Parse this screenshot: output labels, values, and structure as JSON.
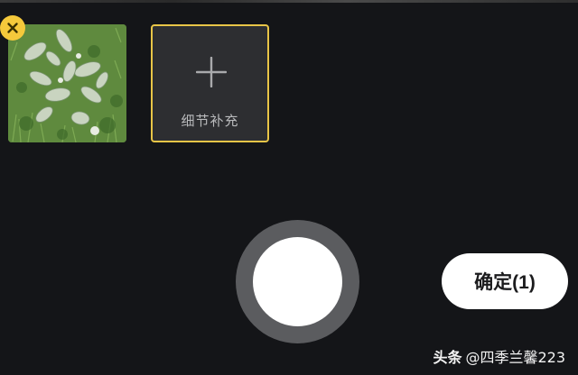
{
  "gallery": {
    "photo_alt": "plant photo",
    "add_tile_label": "细节补充"
  },
  "actions": {
    "confirm_label": "确定(1)"
  },
  "watermark": {
    "brand": "头条",
    "handle": "@四季兰馨223"
  },
  "colors": {
    "background": "#141518",
    "accent_yellow": "#f5c93b",
    "tile_border": "#e8c547",
    "tile_bg": "#2d2e31",
    "shutter_ring": "#5b5c5f",
    "shutter_core": "#ffffff"
  },
  "icons": {
    "remove": "close-icon",
    "add": "plus-icon"
  }
}
